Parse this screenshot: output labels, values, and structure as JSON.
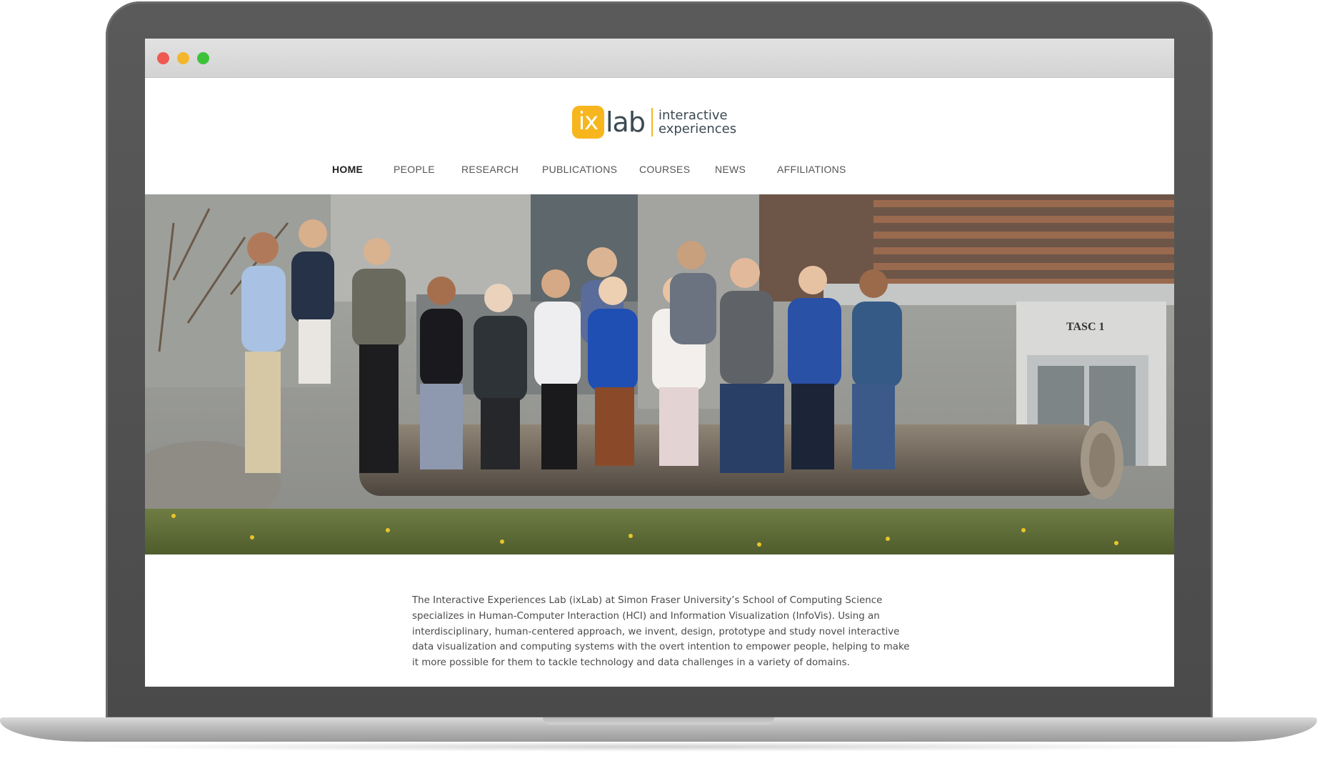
{
  "browser": {
    "window_controls": [
      "close-icon",
      "minimize-icon",
      "maximize-icon"
    ],
    "colors": {
      "close": "#ee5a52",
      "minimize": "#f4b62c",
      "maximize": "#3ec23c"
    }
  },
  "logo": {
    "mark_left": "ix",
    "mark_right": "lab",
    "tagline_line1": "interactive",
    "tagline_line2": "experiences",
    "accent_color": "#f7b61d",
    "text_color": "#3b4a52"
  },
  "nav": {
    "items": [
      {
        "label": "HOME",
        "active": true
      },
      {
        "label": "PEOPLE",
        "active": false
      },
      {
        "label": "RESEARCH",
        "active": false
      },
      {
        "label": "PUBLICATIONS",
        "active": false
      },
      {
        "label": "COURSES",
        "active": false
      },
      {
        "label": "NEWS",
        "active": false
      },
      {
        "label": "AFFILIATIONS",
        "active": false
      }
    ]
  },
  "hero": {
    "sign_text": "TASC 1"
  },
  "intro": {
    "text": "The Interactive Experiences Lab (ixLab) at Simon Fraser University’s School of Computing Science specializes in Human-Computer Interaction (HCI) and Information Visualization (InfoVis). Using an interdisciplinary, human-centered approach, we invent, design, prototype and study novel interactive data visualization and computing systems with the overt intention to empower people, helping to make it more possible for them to tackle technology and data challenges in a variety of domains."
  }
}
